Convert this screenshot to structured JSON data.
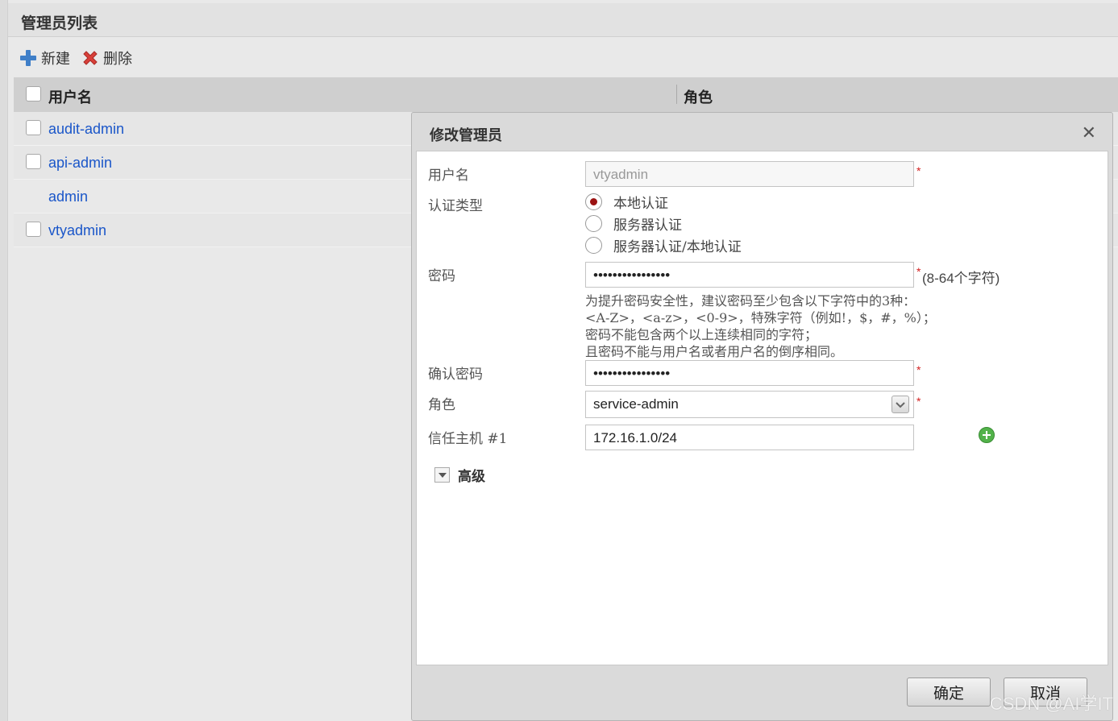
{
  "panel": {
    "title": "管理员列表"
  },
  "toolbar": {
    "new_label": "新建",
    "delete_label": "删除"
  },
  "grid": {
    "headers": {
      "username": "用户名",
      "role": "角色"
    },
    "rows": [
      {
        "name": "audit-admin",
        "has_checkbox": true
      },
      {
        "name": "api-admin",
        "has_checkbox": true
      },
      {
        "name": "admin",
        "has_checkbox": false
      },
      {
        "name": "vtyadmin",
        "has_checkbox": true
      }
    ]
  },
  "dialog": {
    "title": "修改管理员",
    "close_symbol": "✕",
    "username": {
      "label": "用户名",
      "value": "vtyadmin"
    },
    "auth_type": {
      "label": "认证类型",
      "options": [
        "本地认证",
        "服务器认证",
        "服务器认证/本地认证"
      ],
      "selected_index": 0
    },
    "password": {
      "label": "密码",
      "value": "••••••••••••••••",
      "constraint": "(8-64个字符)",
      "hints": [
        "为提升密码安全性，建议密码至少包含以下字符中的3种：",
        "<A-Z>，<a-z>，<0-9>，特殊字符（例如!，$，#，%）；",
        "密码不能包含两个以上连续相同的字符；",
        "且密码不能与用户名或者用户名的倒序相同。"
      ]
    },
    "confirm_password": {
      "label": "确认密码",
      "value": "••••••••••••••••"
    },
    "role": {
      "label": "角色",
      "value": "service-admin"
    },
    "trusted_host": {
      "label": "信任主机 #1",
      "value": "172.16.1.0/24"
    },
    "advanced_label": "高级",
    "required_mark": "*",
    "ok_label": "确定",
    "cancel_label": "取消"
  },
  "watermark": "CSDN @AI学IT",
  "colors": {
    "link": "#1a56c9",
    "required": "#d32020",
    "radio_checked": "#9b1212",
    "add_icon": "#52b24a"
  }
}
